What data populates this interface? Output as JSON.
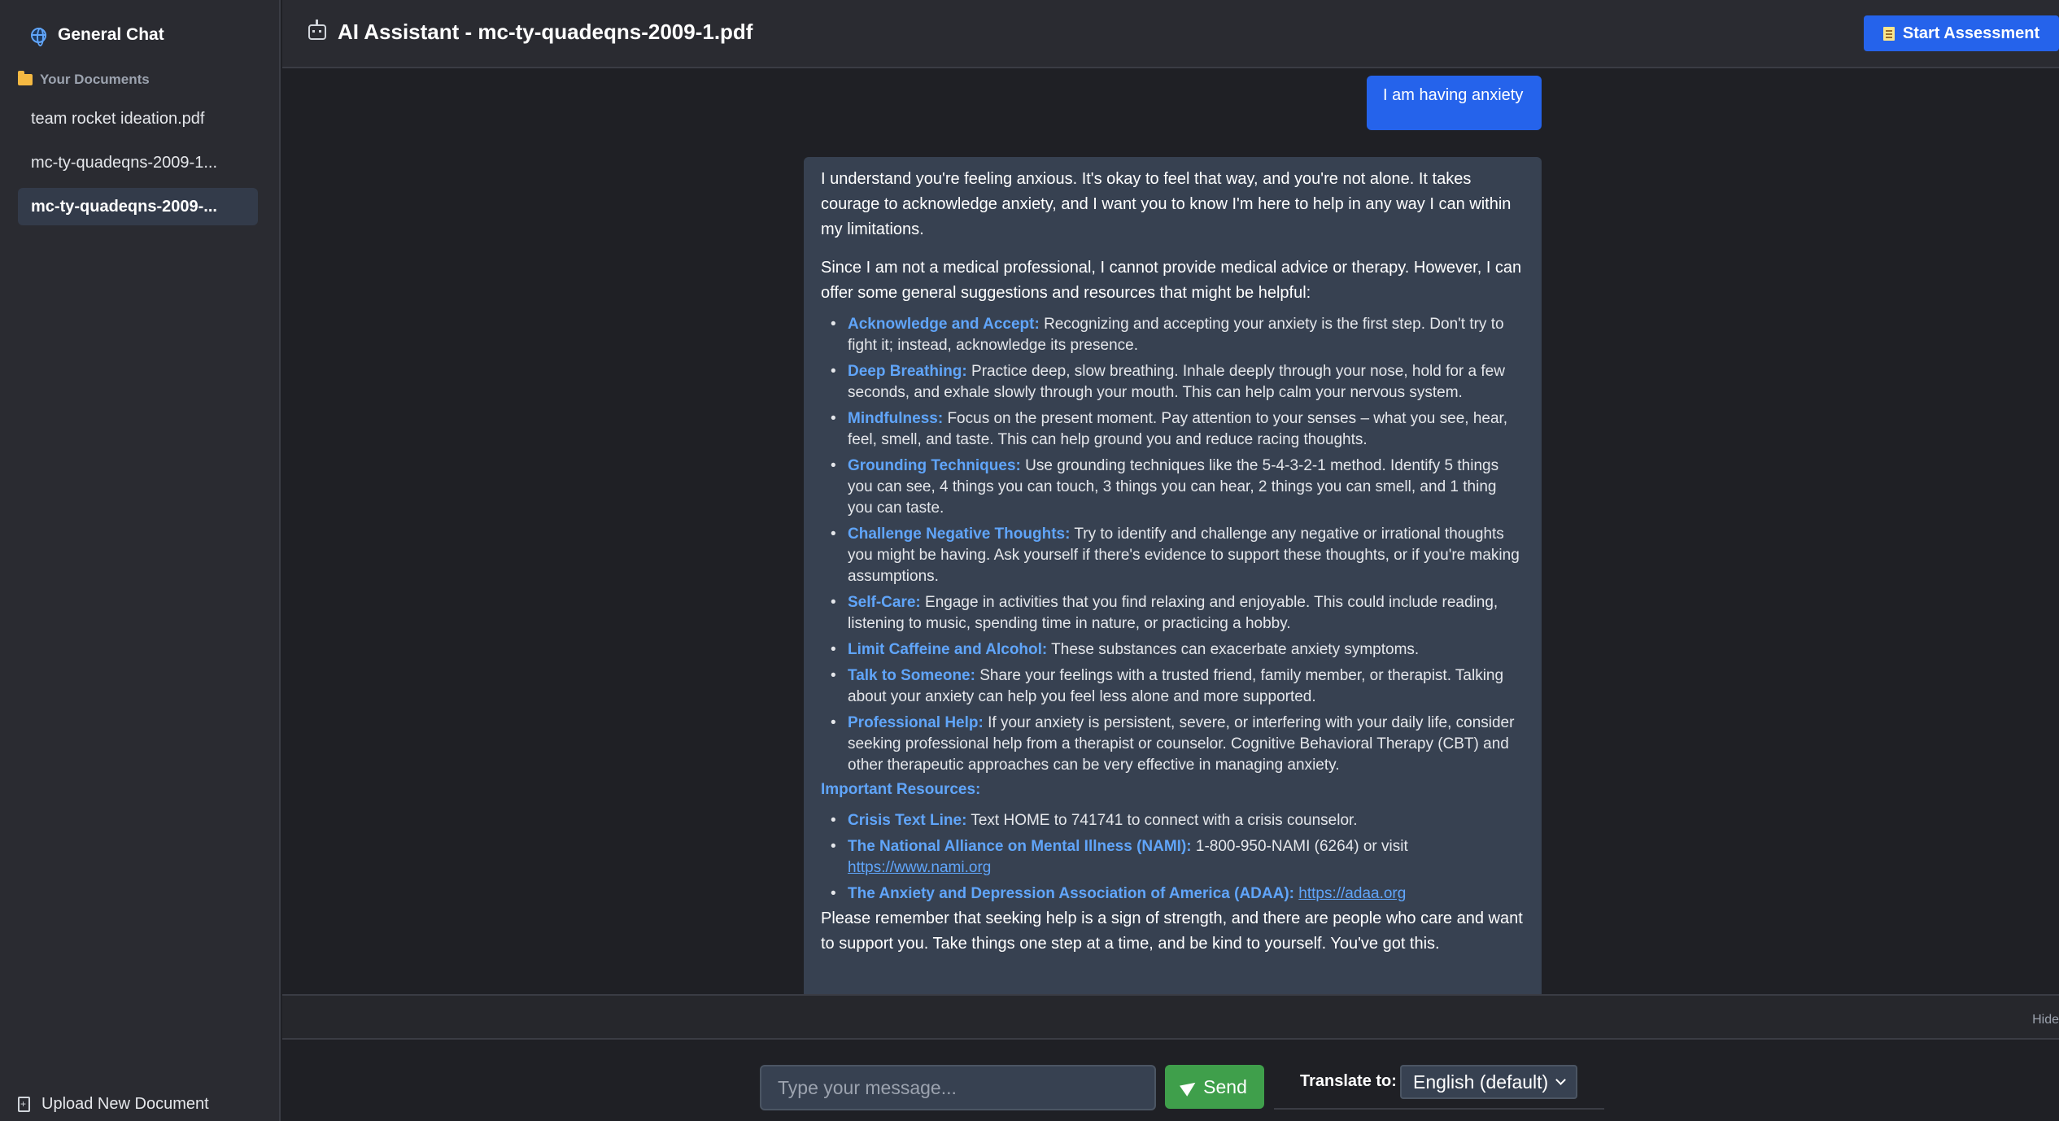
{
  "sidebar": {
    "general_chat": "General Chat",
    "docs_header": "Your Documents",
    "documents": [
      "team rocket ideation.pdf",
      "mc-ty-quadeqns-2009-1...",
      "mc-ty-quadeqns-2009-..."
    ],
    "upload": "Upload New Document"
  },
  "header": {
    "title": "AI Assistant - mc-ty-quadeqns-2009-1.pdf",
    "start_button": "Start Assessment"
  },
  "chat": {
    "user_message": "I am having anxiety",
    "ai": {
      "intro1": "I understand you're feeling anxious. It's okay to feel that way, and you're not alone. It takes courage to acknowledge anxiety, and I want you to know I'm here to help in any way I can within my limitations.",
      "intro2": "Since I am not a medical professional, I cannot provide medical advice or therapy. However, I can offer some general suggestions and resources that might be helpful:",
      "tips": [
        {
          "title": "Acknowledge and Accept:",
          "text": " Recognizing and accepting your anxiety is the first step. Don't try to fight it; instead, acknowledge its presence."
        },
        {
          "title": "Deep Breathing:",
          "text": " Practice deep, slow breathing. Inhale deeply through your nose, hold for a few seconds, and exhale slowly through your mouth. This can help calm your nervous system."
        },
        {
          "title": "Mindfulness:",
          "text": " Focus on the present moment. Pay attention to your senses – what you see, hear, feel, smell, and taste. This can help ground you and reduce racing thoughts."
        },
        {
          "title": "Grounding Techniques:",
          "text": " Use grounding techniques like the 5-4-3-2-1 method. Identify 5 things you can see, 4 things you can touch, 3 things you can hear, 2 things you can smell, and 1 thing you can taste."
        },
        {
          "title": "Challenge Negative Thoughts:",
          "text": " Try to identify and challenge any negative or irrational thoughts you might be having. Ask yourself if there's evidence to support these thoughts, or if you're making assumptions."
        },
        {
          "title": "Self-Care:",
          "text": " Engage in activities that you find relaxing and enjoyable. This could include reading, listening to music, spending time in nature, or practicing a hobby."
        },
        {
          "title": "Limit Caffeine and Alcohol:",
          "text": " These substances can exacerbate anxiety symptoms."
        },
        {
          "title": "Talk to Someone:",
          "text": " Share your feelings with a trusted friend, family member, or therapist. Talking about your anxiety can help you feel less alone and more supported."
        },
        {
          "title": "Professional Help:",
          "text": " If your anxiety is persistent, severe, or interfering with your daily life, consider seeking professional help from a therapist or counselor. Cognitive Behavioral Therapy (CBT) and other therapeutic approaches can be very effective in managing anxiety."
        }
      ],
      "resources_heading": "Important Resources:",
      "resources": [
        {
          "title": "Crisis Text Line:",
          "text": " Text HOME to 741741 to connect with a crisis counselor.",
          "link": ""
        },
        {
          "title": "The National Alliance on Mental Illness (NAMI):",
          "text": " 1-800-950-NAMI (6264) or visit ",
          "link": "https://www.nami.org"
        },
        {
          "title": "The Anxiety and Depression Association of America (ADAA):",
          "text": " ",
          "link": "https://adaa.org"
        }
      ],
      "closing": "Please remember that seeking help is a sign of strength, and there are people who care and want to support you. Take things one step at a time, and be kind to yourself. You've got this."
    }
  },
  "footer": {
    "hide": "Hide",
    "input_placeholder": "Type your message...",
    "send": "Send",
    "translate_label": "Translate to:",
    "language": "English (default)"
  },
  "colors": {
    "accent": "#2563eb",
    "highlight": "#60a5fa",
    "send": "#3f9f4b"
  }
}
